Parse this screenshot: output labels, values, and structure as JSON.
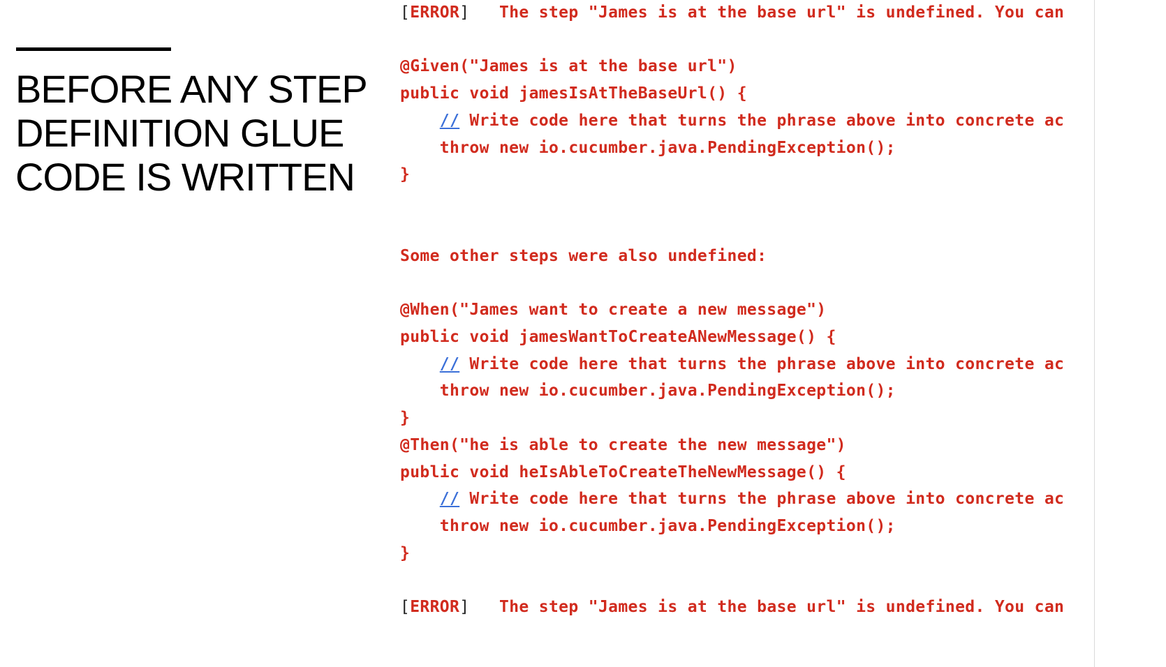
{
  "slide": {
    "title_lines": [
      "BEFORE ANY STEP",
      "DEFINITION GLUE",
      "CODE IS WRITTEN"
    ]
  },
  "console": {
    "error_bracket_open": "[",
    "error_label": "ERROR",
    "error_bracket_close": "]",
    "error_message_1": "   The step \"James is at the base url\" is undefined. You can",
    "error_message_2": "   The step \"James is at the base url\" is undefined. You can",
    "given_annotation": "@Given(\"James is at the base url\")",
    "given_signature": "public void jamesIsAtTheBaseUrl() {",
    "comment_slashes": "//",
    "comment_text": " Write code here that turns the phrase above into concrete ac",
    "throw_statement": "    throw new io.cucumber.java.PendingException();",
    "closing_brace": "}",
    "other_steps_message": "Some other steps were also undefined:",
    "when_annotation": "@When(\"James want to create a new message\")",
    "when_signature": "public void jamesWantToCreateANewMessage() {",
    "then_annotation": "@Then(\"he is able to create the new message\")",
    "then_signature": "public void heIsAbleToCreateTheNewMessage() {"
  },
  "colors": {
    "code_red": "#d12b1e",
    "comment_blue": "#3a6fd8",
    "title_black": "#000000"
  }
}
